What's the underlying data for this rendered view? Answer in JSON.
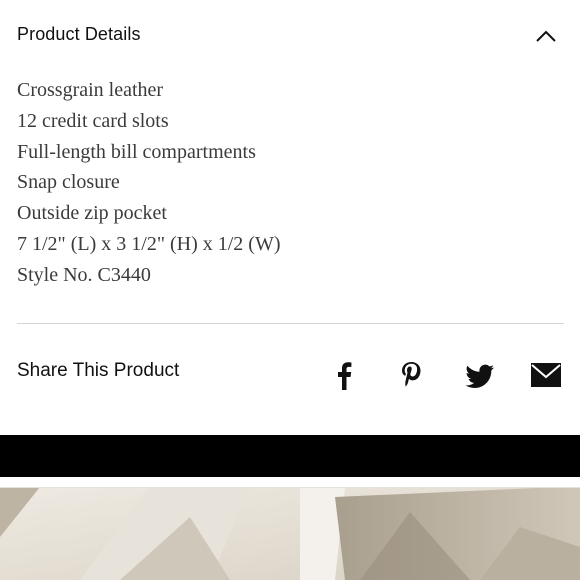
{
  "section": {
    "title": "Product Details"
  },
  "details": [
    "Crossgrain leather",
    "12 credit card slots",
    "Full-length bill compartments",
    "Snap closure",
    "Outside zip pocket",
    "7 1/2\" (L) x 3 1/2\" (H) x 1/2 (W)",
    "Style No. C3440"
  ],
  "share": {
    "label": "Share This Product",
    "icons": [
      "facebook-icon",
      "pinterest-icon",
      "twitter-icon",
      "email-icon"
    ]
  },
  "colors": {
    "text": "#111111",
    "body_text": "#3b3b3b",
    "divider": "#d6d6d6",
    "band": "#000000"
  }
}
